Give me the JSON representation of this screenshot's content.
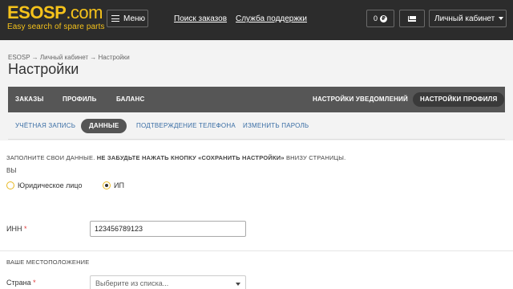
{
  "header": {
    "logo_main": "ESOSP",
    "logo_dotcom": ".com",
    "logo_tagline": "Easy search of spare parts",
    "menu_label": "Меню",
    "links": [
      "Поиск заказов",
      "Служба поддержки"
    ],
    "balance": "0",
    "balance_icon": "₽",
    "account_label": "Личный кабинет"
  },
  "breadcrumb": "ESOSP → Личный кабинет → Настройки",
  "page_title": "Настройки",
  "main_tabs": {
    "orders": "ЗАКАЗЫ",
    "profile": "ПРОФИЛЬ",
    "balance": "БАЛАНС",
    "notification_settings": "НАСТРОЙКИ УВЕДОМЛЕНИЙ",
    "profile_settings": "НАСТРОЙКИ ПРОФИЛЯ"
  },
  "sub_tabs": {
    "account": "УЧЁТНАЯ ЗАПИСЬ",
    "data": "ДАННЫЕ",
    "phone_confirm": "ПОДТВЕРЖДЕНИЕ ТЕЛЕФОНА",
    "change_password": "ИЗМЕНИТЬ ПАРОЛЬ"
  },
  "form": {
    "notice_pre": "ЗАПОЛНИТЕ СВОИ ДАННЫЕ. ",
    "notice_bold": "НЕ ЗАБУДЬТЕ НАЖАТЬ КНОПКУ «СОХРАНИТЬ НАСТРОЙКИ»",
    "notice_post": " ВНИЗУ СТРАНИЦЫ.",
    "you_label": "ВЫ",
    "radio_legal": "Юридическое лицо",
    "radio_ip": "ИП",
    "inn_label": "ИНН",
    "required_mark": "*",
    "inn_value": "123456789123",
    "location_title": "ВАШЕ МЕСТОПОЛОЖЕНИЕ",
    "country_label": "Страна",
    "country_placeholder": "Выберите из списка..."
  },
  "colors": {
    "brand_yellow": "#f5c21b",
    "header_bg": "#2c2c2c",
    "tabs_bg": "#565656",
    "link_blue": "#3a6ea5",
    "required_red": "#e03b3b"
  }
}
